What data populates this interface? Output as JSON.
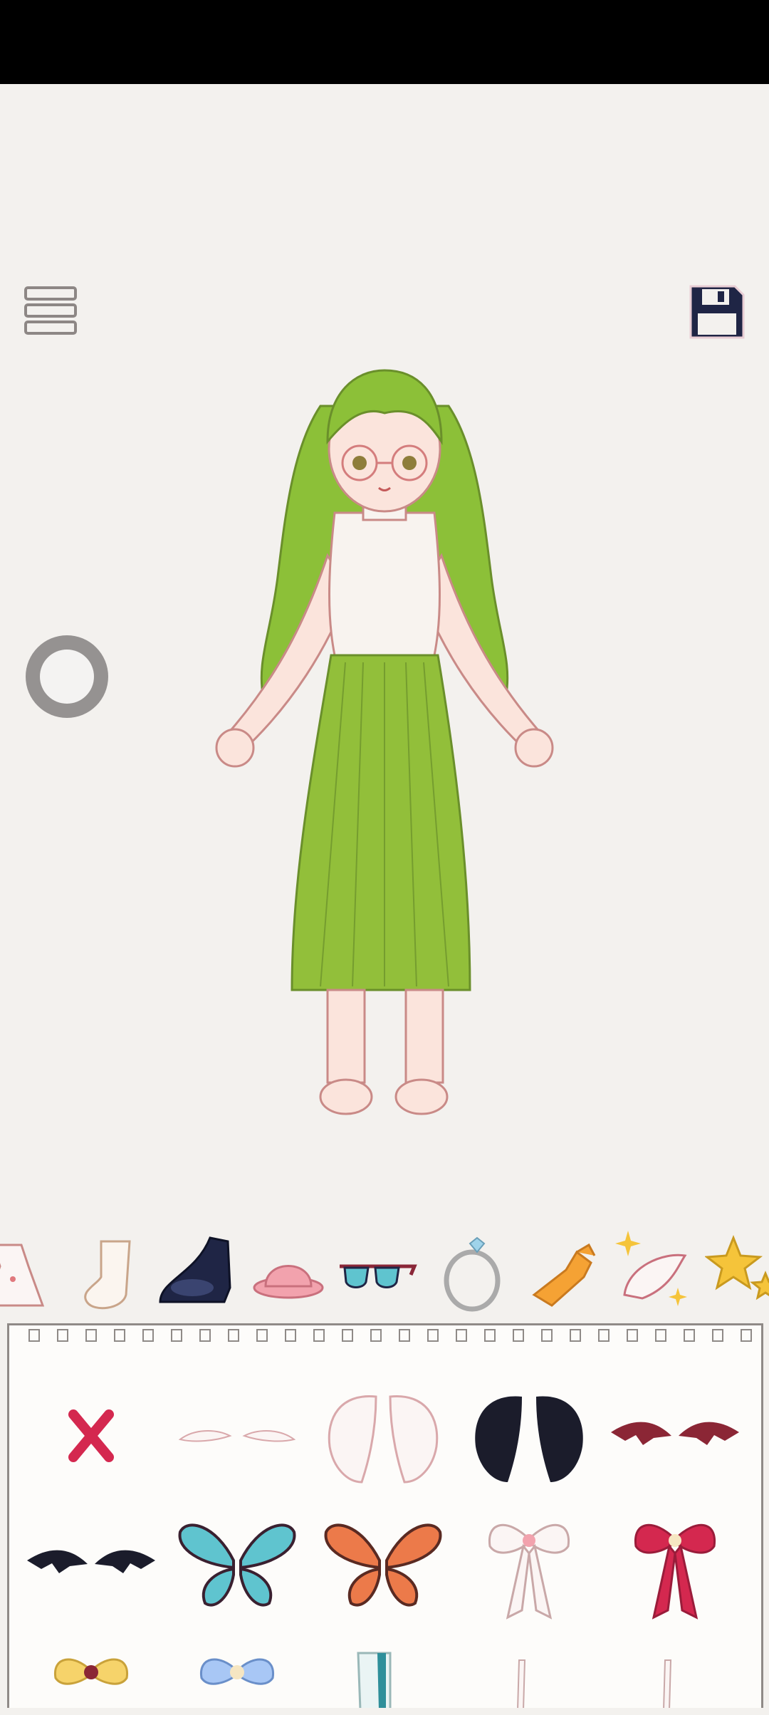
{
  "app": {
    "screen": "dress-up editor"
  },
  "toolbar": {
    "menu_icon": "hamburger-menu-icon",
    "save_icon": "floppy-disk-icon",
    "record_icon": "record-circle-icon"
  },
  "categories": [
    {
      "name": "dress",
      "icon": "dress-icon"
    },
    {
      "name": "socks",
      "icon": "sock-icon"
    },
    {
      "name": "shoes",
      "icon": "shoe-icon",
      "selected": false
    },
    {
      "name": "hat",
      "icon": "hat-icon"
    },
    {
      "name": "glasses",
      "icon": "sunglasses-icon"
    },
    {
      "name": "jewelry",
      "icon": "ring-icon"
    },
    {
      "name": "scarf",
      "icon": "scarf-icon"
    },
    {
      "name": "wings",
      "icon": "wing-icon",
      "selected": true
    },
    {
      "name": "effects",
      "icon": "star-icon"
    }
  ],
  "items": [
    {
      "name": "none",
      "icon": "remove-x-icon"
    },
    {
      "name": "small-white-wings",
      "icon": "small-wings-icon"
    },
    {
      "name": "white-angel-wings",
      "icon": "angel-wings-icon"
    },
    {
      "name": "black-feather-wings",
      "icon": "black-wings-icon"
    },
    {
      "name": "red-bat-wings",
      "icon": "bat-wings-icon"
    },
    {
      "name": "black-bat-wings",
      "icon": "bat-wings-icon"
    },
    {
      "name": "blue-butterfly-wings",
      "icon": "butterfly-wings-icon"
    },
    {
      "name": "orange-butterfly-wings",
      "icon": "butterfly-wings-icon"
    },
    {
      "name": "white-ribbon-bow",
      "icon": "bow-icon"
    },
    {
      "name": "pink-ribbon-bow",
      "icon": "bow-icon"
    },
    {
      "name": "yellow-bow",
      "icon": "bow-icon"
    },
    {
      "name": "blue-bow",
      "icon": "bow-icon"
    },
    {
      "name": "teal-item",
      "icon": "item-icon"
    },
    {
      "name": "thin-item-1",
      "icon": "item-icon"
    },
    {
      "name": "thin-item-2",
      "icon": "item-icon"
    }
  ],
  "colors": {
    "background": "#f3f1ee",
    "hair": "#8cc038",
    "skirt": "#92bf3a",
    "accent_red": "#d4284f"
  }
}
